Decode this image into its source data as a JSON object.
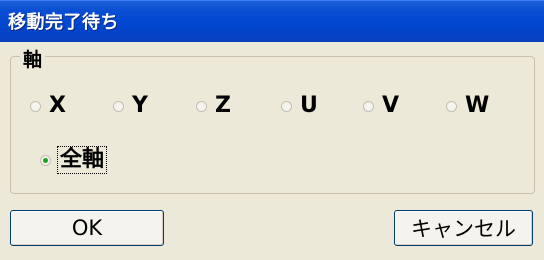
{
  "window": {
    "title": "移動完了待ち"
  },
  "axis_group": {
    "label": "軸",
    "options": [
      {
        "label": "X",
        "checked": false
      },
      {
        "label": "Y",
        "checked": false
      },
      {
        "label": "Z",
        "checked": false
      },
      {
        "label": "U",
        "checked": false
      },
      {
        "label": "V",
        "checked": false
      },
      {
        "label": "W",
        "checked": false
      }
    ],
    "all_axes": {
      "label": "全軸",
      "checked": true
    }
  },
  "buttons": {
    "ok_label": "OK",
    "cancel_label": "キャンセル"
  },
  "colors": {
    "titlebar": "#0046d0",
    "dialog_bg": "#ece9d8",
    "radio_dot": "#21a121"
  }
}
